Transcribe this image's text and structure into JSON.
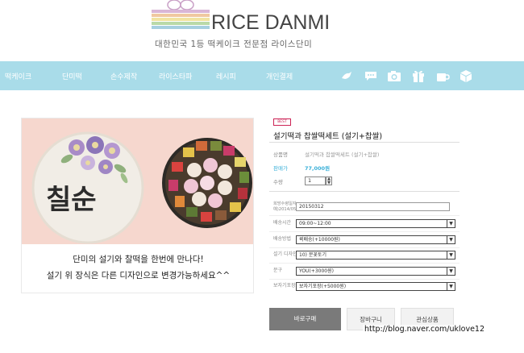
{
  "brand": {
    "name": "RICE DANMI",
    "tagline": "대한민국 1등 떡케이크 전문점 라이스단미",
    "logo_colors": [
      "#d9b6d6",
      "#f0c9a0",
      "#f1e3a1",
      "#b9d9a8",
      "#a6cfe0"
    ]
  },
  "nav": {
    "bg": "#a9dce9",
    "items": [
      "떡케이크",
      "단미떡",
      "손수제작",
      "라이스타파",
      "레시피",
      "개인결제"
    ],
    "icons": [
      "bird-icon",
      "chat-icon",
      "camera-icon",
      "gift-icon",
      "cup-icon",
      "box-icon"
    ]
  },
  "product": {
    "badge": "BEST",
    "title": "설기떡과 찹쌀떡세트 (설기+찹쌀)",
    "image_caption_1": "단미의 설기와 찰떡을 한번에 만나다!",
    "image_caption_2": "설기 위 장식은 다른 디자인으로 변경가능하세요^^",
    "cake_text": "칠순",
    "fields": [
      {
        "label": "상품명",
        "value": "설기떡과 찹쌀떡세트 (설기+찹쌀)"
      },
      {
        "label": "판매가",
        "value": "77,000원"
      },
      {
        "label": "수량",
        "value": "1"
      }
    ],
    "options": [
      {
        "label": "희망수령일자\n예)2014/05/05",
        "type": "input",
        "value": "20150312"
      },
      {
        "label": "배송시간",
        "type": "select",
        "value": "09:00~12:00"
      },
      {
        "label": "배송방법",
        "type": "select",
        "value": "퀵배송(+10000원)"
      },
      {
        "label": "설기 디자인",
        "type": "select",
        "value": "10) 분꽃토기"
      },
      {
        "label": "문구",
        "type": "select",
        "value": "YOU(+3000원)"
      },
      {
        "label": "보자기포장",
        "type": "select",
        "value": "보자기포장(+5000원)"
      }
    ]
  },
  "buttons": {
    "buy": "바로구매",
    "cart": "장바구니",
    "wish": "관심상품"
  },
  "watermark": "http://blog.naver.com/uklove12",
  "colors": {
    "accent": "#3ab0d8",
    "image_bg": "#f6d7ce"
  }
}
